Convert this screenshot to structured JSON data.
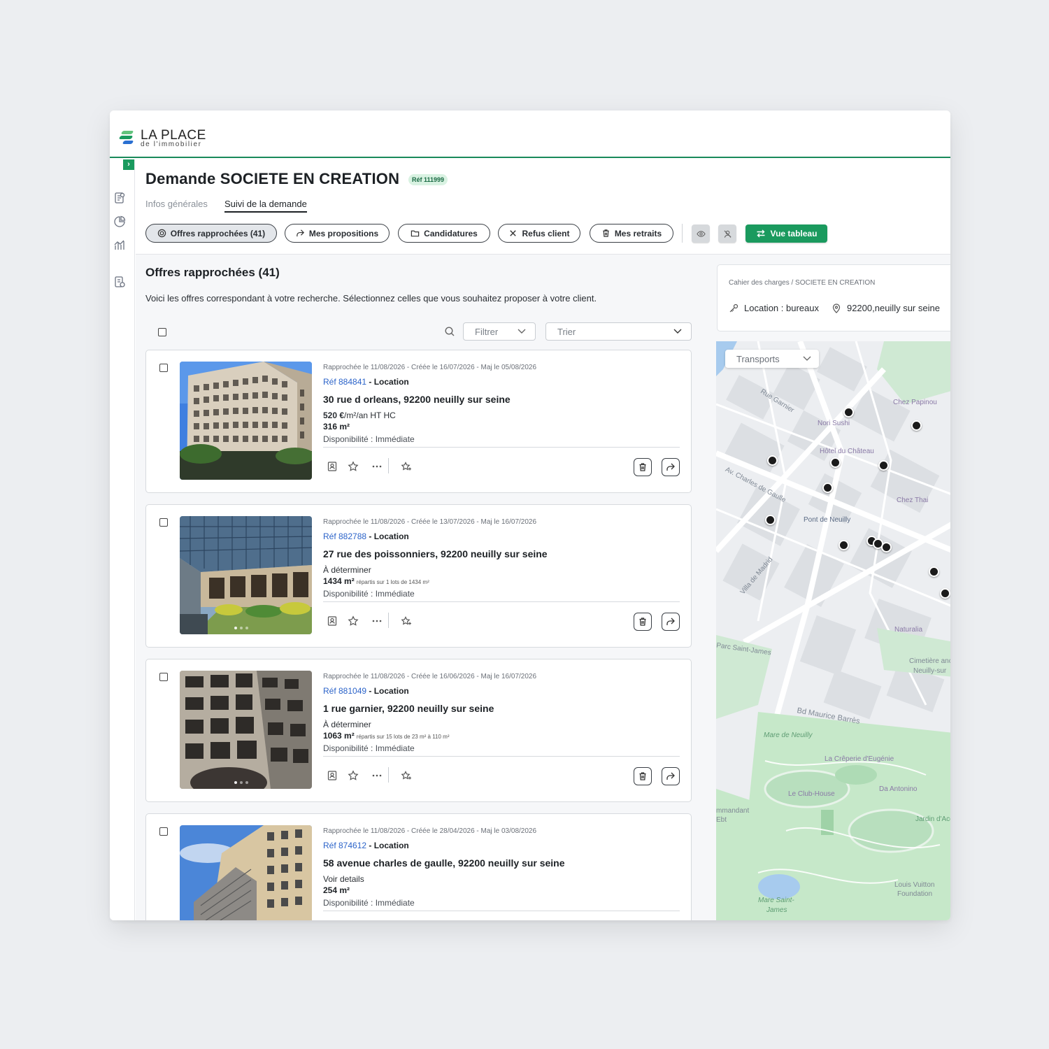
{
  "brand": {
    "title": "LA PLACE",
    "subtitle": "de l'immobilier",
    "colors": [
      "#1a9a5e",
      "#63c37d",
      "#2a6fd1"
    ]
  },
  "page": {
    "title": "Demande SOCIETE EN CREATION",
    "ref_badge": "Réf 111999",
    "tabs": [
      {
        "label": "Infos générales",
        "active": false
      },
      {
        "label": "Suivi de la demande",
        "active": true
      }
    ]
  },
  "toolbar": {
    "pills": [
      {
        "label": "Offres rapprochées (41)",
        "icon": "target-icon",
        "active": true
      },
      {
        "label": "Mes propositions",
        "icon": "share-icon",
        "active": false
      },
      {
        "label": "Candidatures",
        "icon": "folder-icon",
        "active": false
      },
      {
        "label": "Refus client",
        "icon": "close-icon",
        "active": false
      },
      {
        "label": "Mes retraits",
        "icon": "trash-icon",
        "active": false
      }
    ],
    "icon_buttons": [
      "eye-icon",
      "person-off-icon"
    ],
    "view_button": "Vue tableau"
  },
  "list": {
    "title": "Offres rapprochées (41)",
    "description": "Voici les offres correspondant à votre recherche. Sélectionnez celles que vous souhaitez proposer à votre client.",
    "filter_label": "Filtrer",
    "sort_label": "Trier",
    "offers": [
      {
        "dates": "Rapprochée le 11/08/2026 - Créée le 16/07/2026 - Maj le 05/08/2026",
        "ref": "Réf 884841",
        "type": " - Location",
        "address": "30 rue d orleans, 92200 neuilly sur seine",
        "price_value": "520 €",
        "price_unit": "/m²/an HT HC",
        "surface": "316 m²",
        "surface_note": "",
        "availability": "Disponibilité : Immédiate"
      },
      {
        "dates": "Rapprochée le 11/08/2026 - Créée le 13/07/2026 - Maj le 16/07/2026",
        "ref": "Réf 882788",
        "type": " - Location",
        "address": "27 rue des poissonniers, 92200 neuilly sur seine",
        "price_value": "",
        "price_unit": "À déterminer",
        "surface": "1434 m²",
        "surface_note": "répartis sur 1 lots de 1434 m²",
        "availability": "Disponibilité : Immédiate"
      },
      {
        "dates": "Rapprochée le 11/08/2026 - Créée le 16/06/2026 - Maj le 16/07/2026",
        "ref": "Réf 881049",
        "type": " - Location",
        "address": "1 rue garnier, 92200 neuilly sur seine",
        "price_value": "",
        "price_unit": "À déterminer",
        "surface": "1063 m²",
        "surface_note": "répartis sur 15 lots de 23 m² à 110 m²",
        "availability": "Disponibilité : Immédiate"
      },
      {
        "dates": "Rapprochée le 11/08/2026 - Créée le 28/04/2026 - Maj le 03/08/2026",
        "ref": "Réf 874612",
        "type": " - Location",
        "address": "58 avenue charles de gaulle, 92200 neuilly sur seine",
        "price_value": "",
        "price_unit": "Voir details",
        "surface": "254 m²",
        "surface_note": "",
        "availability": "Disponibilité : Immédiate"
      }
    ]
  },
  "criteria": {
    "breadcrumb": "Cahier des charges / SOCIETE EN CREATION",
    "type": "Location : bureaux",
    "location": "92200,neuilly sur seine"
  },
  "map": {
    "transports_label": "Transports",
    "labels": {
      "street_1": "Rue Garnier",
      "street_2": "Av. Charles de Gaulle",
      "street_3": "Bd Maurice Barrès",
      "street_4": "Villa de Madrid",
      "street_5": "Parc Saint-James",
      "poi_1": "Nori Sushi",
      "poi_2": "Hôtel du Château",
      "poi_3": "Chez Papinou",
      "poi_4": "Chez Thai",
      "poi_5": "Pont de Neuilly",
      "poi_6": "Naturalia",
      "poi_7": "Cimetière ancien",
      "poi_8": "Neuilly-sur",
      "poi_9": "La Crêperie d'Eugénie",
      "poi_10": "Le Club-House",
      "poi_11": "Da Antonino",
      "poi_12": "Jardin d'Accl",
      "poi_13": "Louis Vuitton",
      "poi_14": "Foundation",
      "park_1": "Mare de Neuilly",
      "park_2": "Mare Saint-",
      "park_3": "James",
      "edge_1": "mmandant",
      "edge_2": "Ebt"
    },
    "pins_count": 13
  }
}
